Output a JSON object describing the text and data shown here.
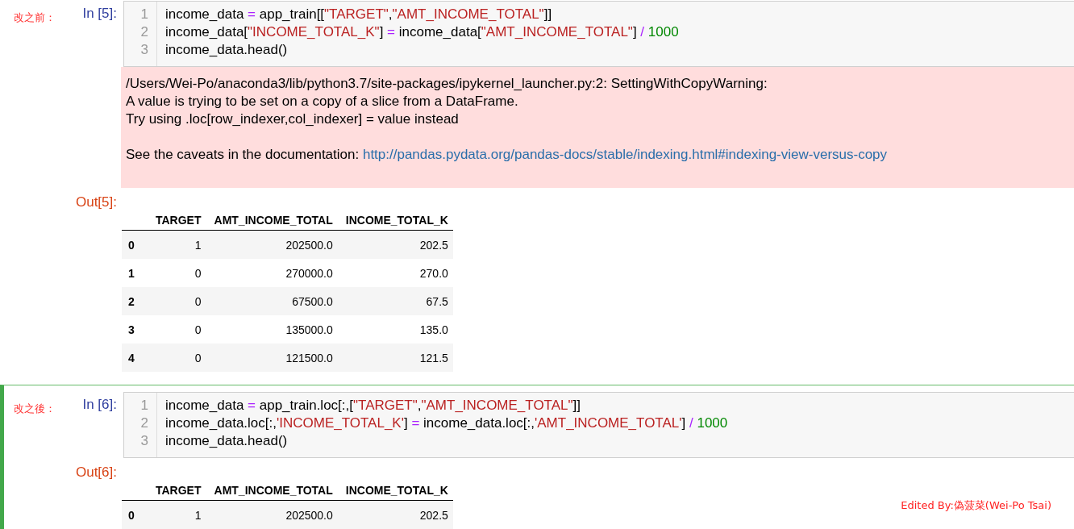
{
  "cells": [
    {
      "selected": false,
      "annotation": "改之前：",
      "prompt": "In [5]:",
      "lines": [
        {
          "number": "1",
          "tokens": [
            {
              "kind": "plain",
              "text": "income_data "
            },
            {
              "kind": "operator",
              "text": "="
            },
            {
              "kind": "plain",
              "text": " app_train[["
            },
            {
              "kind": "string",
              "text": "\"TARGET\""
            },
            {
              "kind": "plain",
              "text": ","
            },
            {
              "kind": "string",
              "text": "\"AMT_INCOME_TOTAL\""
            },
            {
              "kind": "plain",
              "text": "]]"
            }
          ]
        },
        {
          "number": "2",
          "tokens": [
            {
              "kind": "plain",
              "text": "income_data["
            },
            {
              "kind": "string",
              "text": "\"INCOME_TOTAL_K\""
            },
            {
              "kind": "plain",
              "text": "] "
            },
            {
              "kind": "operator",
              "text": "="
            },
            {
              "kind": "plain",
              "text": " income_data["
            },
            {
              "kind": "string",
              "text": "\"AMT_INCOME_TOTAL\""
            },
            {
              "kind": "plain",
              "text": "] "
            },
            {
              "kind": "operator",
              "text": "/ "
            },
            {
              "kind": "number",
              "text": "1000"
            }
          ]
        },
        {
          "number": "3",
          "tokens": [
            {
              "kind": "plain",
              "text": "income_data.head()"
            }
          ]
        }
      ],
      "stderr": {
        "lines": [
          "/Users/Wei-Po/anaconda3/lib/python3.7/site-packages/ipykernel_launcher.py:2: SettingWithCopyWarning:",
          "A value is trying to be set on a copy of a slice from a DataFrame.",
          "Try using .loc[row_indexer,col_indexer] = value instead"
        ],
        "doc_text": "See the caveats in the documentation: ",
        "link": "http://pandas.pydata.org/pandas-docs/stable/indexing.html#indexing-view-versus-copy"
      },
      "out_prompt": "Out[5]:",
      "table": {
        "columns": [
          "TARGET",
          "AMT_INCOME_TOTAL",
          "INCOME_TOTAL_K"
        ],
        "rows": [
          {
            "index": "0",
            "cells": [
              "1",
              "202500.0",
              "202.5"
            ]
          },
          {
            "index": "1",
            "cells": [
              "0",
              "270000.0",
              "270.0"
            ]
          },
          {
            "index": "2",
            "cells": [
              "0",
              "67500.0",
              "67.5"
            ]
          },
          {
            "index": "3",
            "cells": [
              "0",
              "135000.0",
              "135.0"
            ]
          },
          {
            "index": "4",
            "cells": [
              "0",
              "121500.0",
              "121.5"
            ]
          }
        ]
      }
    },
    {
      "selected": true,
      "annotation": "改之後：",
      "prompt": "In [6]:",
      "lines": [
        {
          "number": "1",
          "tokens": [
            {
              "kind": "plain",
              "text": "income_data "
            },
            {
              "kind": "operator",
              "text": "="
            },
            {
              "kind": "plain",
              "text": " app_train.loc[:,["
            },
            {
              "kind": "string",
              "text": "\"TARGET\""
            },
            {
              "kind": "plain",
              "text": ","
            },
            {
              "kind": "string",
              "text": "\"AMT_INCOME_TOTAL\""
            },
            {
              "kind": "plain",
              "text": "]]"
            }
          ]
        },
        {
          "number": "2",
          "tokens": [
            {
              "kind": "plain",
              "text": "income_data.loc[:,"
            },
            {
              "kind": "string",
              "text": "'INCOME_TOTAL_K'"
            },
            {
              "kind": "plain",
              "text": "] "
            },
            {
              "kind": "operator",
              "text": "="
            },
            {
              "kind": "plain",
              "text": " income_data.loc[:,"
            },
            {
              "kind": "string",
              "text": "'AMT_INCOME_TOTAL'"
            },
            {
              "kind": "plain",
              "text": "] "
            },
            {
              "kind": "operator",
              "text": "/ "
            },
            {
              "kind": "number",
              "text": "1000"
            }
          ]
        },
        {
          "number": "3",
          "tokens": [
            {
              "kind": "plain",
              "text": "income_data.head()"
            }
          ]
        }
      ],
      "out_prompt": "Out[6]:",
      "table": {
        "columns": [
          "TARGET",
          "AMT_INCOME_TOTAL",
          "INCOME_TOTAL_K"
        ],
        "rows": [
          {
            "index": "0",
            "cells": [
              "1",
              "202500.0",
              "202.5"
            ]
          }
        ]
      }
    }
  ],
  "signature": "Edited By:偽菠菜(Wei-Po Tsai)"
}
